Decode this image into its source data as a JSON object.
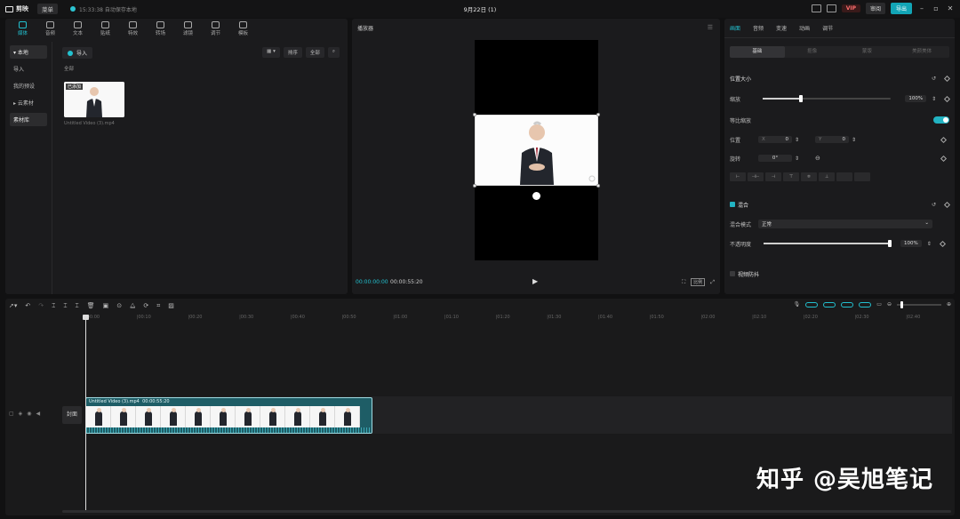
{
  "titlebar": {
    "app_name": "剪映",
    "menu_label": "菜单",
    "autosave": "15:33:38 自动保存本地",
    "doc_title": "9月22日 (1)",
    "vip": "VIP",
    "share_label": "审阅",
    "export_label": "导出"
  },
  "toolbar_tabs": [
    {
      "label": "媒体",
      "icon": "media-icon"
    },
    {
      "label": "音频",
      "icon": "audio-icon"
    },
    {
      "label": "文本",
      "icon": "text-icon"
    },
    {
      "label": "贴纸",
      "icon": "sticker-icon"
    },
    {
      "label": "特效",
      "icon": "effects-icon"
    },
    {
      "label": "转场",
      "icon": "transition-icon"
    },
    {
      "label": "滤镜",
      "icon": "filter-icon"
    },
    {
      "label": "调节",
      "icon": "adjust-icon"
    },
    {
      "label": "模板",
      "icon": "template-icon"
    }
  ],
  "sidebar": [
    {
      "label": "▾ 本地"
    },
    {
      "label": "导入"
    },
    {
      "label": "我的预设"
    },
    {
      "label": "▸ 云素材"
    },
    {
      "label": "素材库"
    }
  ],
  "media": {
    "import_label": "导入",
    "sort_label": "排序",
    "filter_label": "全部",
    "all_label": "全部",
    "thumb_tag": "已添加",
    "thumb_caption": "Untitled Video (3).mp4"
  },
  "player": {
    "title": "播放器",
    "time_current": "00:00:00:00",
    "time_total": "00:00:55:20",
    "ratio": "比例"
  },
  "inspector": {
    "tabs": [
      "画面",
      "音频",
      "变速",
      "动画",
      "调节"
    ],
    "sub_tabs": [
      "基础",
      "抠像",
      "蒙版",
      "美颜美体"
    ],
    "position_size": "位置大小",
    "scale_label": "缩放",
    "scale_value": 0.3,
    "scale_text": "100%",
    "uniform_scale": "等比缩放",
    "position_label": "位置",
    "pos_x_label": "X",
    "pos_x": "0",
    "pos_y_label": "Y",
    "pos_y": "0",
    "rotate_label": "旋转",
    "rotate_value": "0°",
    "blend_label": "混合",
    "blend_mode_label": "混合模式",
    "blend_mode_value": "正常",
    "opacity_label": "不透明度",
    "opacity_value": 1.0,
    "opacity_text": "100%",
    "stabilize_label": "视频防抖"
  },
  "timeline": {
    "ruler": [
      "00:00",
      "00:10",
      "00:20",
      "00:30",
      "00:40",
      "00:50",
      "01:00",
      "01:10",
      "01:20",
      "01:30",
      "01:40",
      "01:50",
      "02:00",
      "02:10",
      "02:20",
      "02:30",
      "02:40"
    ],
    "cover_label": "封面",
    "clip_name": "Untitled Video (3).mp4",
    "clip_duration": "00:00:55:20"
  },
  "watermark": "知乎 @吴旭笔记"
}
